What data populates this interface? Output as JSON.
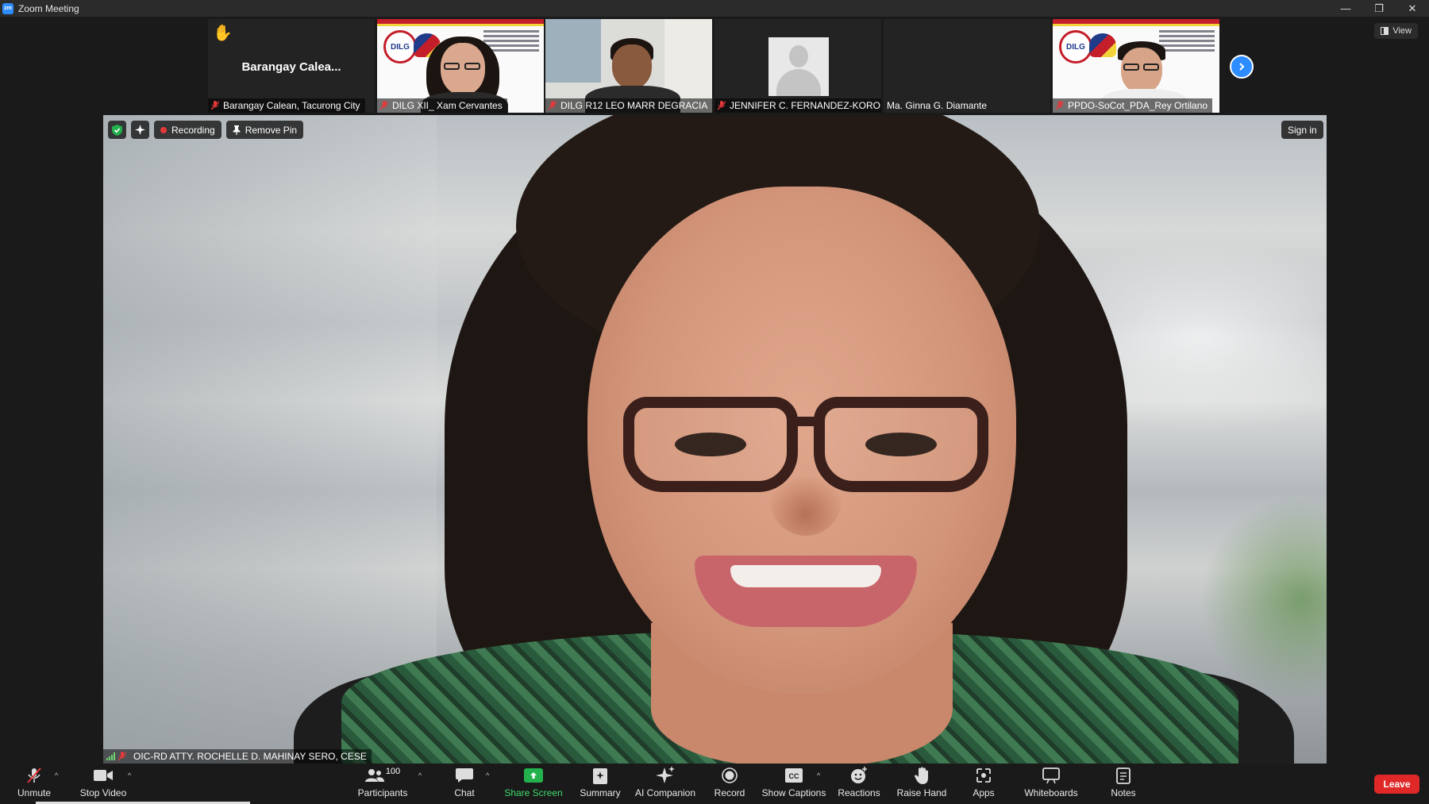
{
  "window": {
    "title": "Zoom Meeting",
    "logo_text": "zm",
    "controls": {
      "minimize": "—",
      "restore": "❐",
      "close": "✕"
    }
  },
  "view_button": {
    "label": "View"
  },
  "gallery": {
    "tiles": [
      {
        "name": "Barangay Calean, Tacurong City",
        "center_label": "Barangay  Calea...",
        "raised_hand": "✋"
      },
      {
        "name": "DILG XII_ Xam Cervantes",
        "logo": "DILG"
      },
      {
        "name": "DILG R12 LEO MARR DEGRACIA"
      },
      {
        "name": "JENNIFER C. FERNANDEZ-KORO..."
      },
      {
        "name": "Ma. Ginna G. Diamante"
      },
      {
        "name": "PPDO-SoCot_PDA_Rey Ortilano",
        "logo": "DILG"
      }
    ]
  },
  "main_video": {
    "recording_label": "Recording",
    "remove_pin_label": "Remove Pin",
    "sign_in_label": "Sign in",
    "speaker_name": "OIC-RD ATTY. ROCHELLE D. MAHINAY SERO, CESE"
  },
  "toolbar": {
    "unmute": "Unmute",
    "stop_video": "Stop Video",
    "participants": "Participants",
    "participants_count": "100",
    "chat": "Chat",
    "share_screen": "Share Screen",
    "summary": "Summary",
    "ai_companion": "AI Companion",
    "record": "Record",
    "show_captions": "Show Captions",
    "captions_icon": "CC",
    "reactions": "Reactions",
    "raise_hand": "Raise Hand",
    "apps": "Apps",
    "whiteboards": "Whiteboards",
    "notes": "Notes",
    "leave": "Leave"
  },
  "colors": {
    "accent_blue": "#2d8cff",
    "share_green": "#22b14c",
    "leave_red": "#e02828",
    "muted_red": "#e5383b"
  }
}
